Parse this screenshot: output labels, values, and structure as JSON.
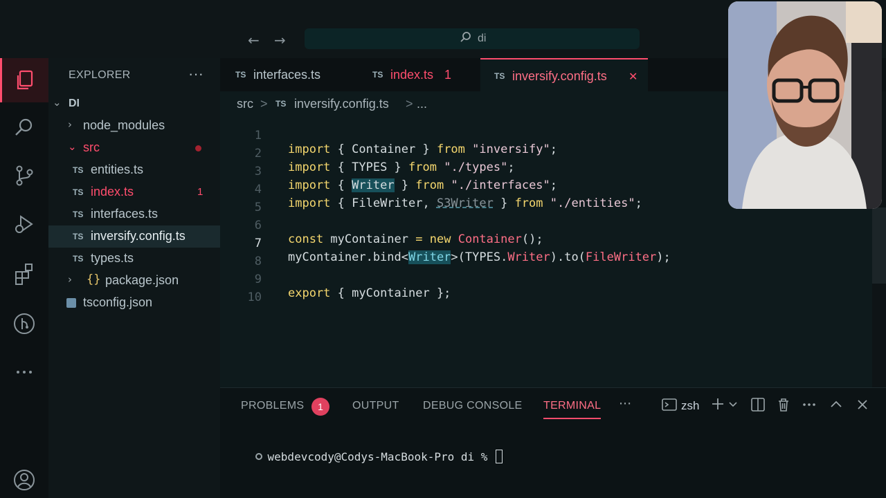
{
  "titlebar": {
    "back_glyph": "←",
    "forward_glyph": "→",
    "search_glyph": "⌕",
    "search_text": "di"
  },
  "activity": {
    "icons": [
      "explorer-icon",
      "search-icon",
      "source-control-icon",
      "run-debug-icon",
      "extensions-icon",
      "git-graph-icon",
      "more-icon",
      "account-icon"
    ]
  },
  "sidebar": {
    "title": "EXPLORER",
    "more": "···",
    "root": "DI",
    "items": [
      {
        "label": "node_modules",
        "kind": "folder"
      },
      {
        "label": "src",
        "kind": "folder-open"
      },
      {
        "label": "entities.ts",
        "kind": "ts"
      },
      {
        "label": "index.ts",
        "kind": "ts",
        "badge": "1"
      },
      {
        "label": "interfaces.ts",
        "kind": "ts"
      },
      {
        "label": "inversify.config.ts",
        "kind": "ts"
      },
      {
        "label": "types.ts",
        "kind": "ts"
      },
      {
        "label": "package.json",
        "kind": "json"
      },
      {
        "label": "tsconfig.json",
        "kind": "tsconfig"
      }
    ],
    "ts_tag": "TS",
    "braces": "{}",
    "chev_right": "›",
    "chev_down": "⌄"
  },
  "tabs": [
    {
      "label": "interfaces.ts",
      "tag": "TS"
    },
    {
      "label": "index.ts",
      "tag": "TS",
      "badge": "1"
    },
    {
      "label": "inversify.config.ts",
      "tag": "TS",
      "close": "✕"
    }
  ],
  "breadcrumb": {
    "folder": "src",
    "sep": ">",
    "file": "inversify.config.ts",
    "tag": "TS",
    "more": "..."
  },
  "editor": {
    "line_numbers": [
      "1",
      "2",
      "3",
      "4",
      "5",
      "6",
      "7",
      "8",
      "9",
      "10"
    ],
    "current_line": "7"
  },
  "panel": {
    "tabs": [
      "PROBLEMS",
      "OUTPUT",
      "DEBUG CONSOLE",
      "TERMINAL"
    ],
    "problems_count": "1",
    "more": "···",
    "shell": "zsh",
    "terminal_prompt": "webdevcody@Codys-MacBook-Pro di % "
  },
  "colors": {
    "accent": "#ff4d6d",
    "editor_bg": "#0e1a1c",
    "keyword": "#f5d76e",
    "type": "#ff6f86"
  }
}
